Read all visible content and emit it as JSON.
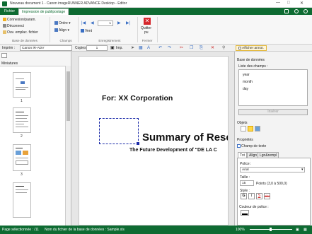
{
  "window": {
    "title": "Nouveau document 1 - Canon imageRUNNER ADVANCE Desktop - Editor"
  },
  "ribbon_tabs": [
    "Fichier",
    "Impression de publipostage"
  ],
  "ribbon": {
    "db_group": {
      "connect": "Connexion/param.",
      "disconnect": "Déconnect",
      "open_file": "Ouv. emplac. fichier",
      "label": "Base de données"
    },
    "fields_group": {
      "order": "Ordre",
      "align": "Align",
      "label": "Champs"
    },
    "records_group": {
      "page_value": "1",
      "show": "Vent",
      "label": "Enregistrement"
    },
    "close_group": {
      "quit": "Quitter",
      "quit2": "pu",
      "label": "Fermer"
    }
  },
  "printbar": {
    "printer_label": "Imprim :",
    "printer_value": "Canon iR-ADV",
    "copies_label": "Copies :",
    "copies_value": "1",
    "imp_label": "Imp.",
    "show_annot": "Afficher annot."
  },
  "left_panel": {
    "title": "Miniatures",
    "pages": [
      "1",
      "2",
      "3"
    ]
  },
  "document": {
    "for_line": "For: XX Corporation",
    "summary": "Summary of Rese",
    "subtitle": "The Future Development of “DE LA C"
  },
  "right_panel": {
    "database_label": "Base de données",
    "fields_list_label": "Liste des champs :",
    "fields": [
      "year",
      "month",
      "day"
    ],
    "insert_button": "Insérer",
    "objects_label": "Objets",
    "properties_label": "Propriétés",
    "text_field_label": "Champ de texte",
    "tabs": [
      "Txt",
      "Align",
      "Lgn&rempl"
    ],
    "font_label": "Police :",
    "font_value": "Arial",
    "size_label": "Taille :",
    "size_value": "15",
    "size_hint": "Points (3,0 à 500,0)",
    "style_label": "Style :",
    "style_buttons": [
      "G",
      "I",
      "S",
      "abc"
    ],
    "font_color_label": "Couleur de police :"
  },
  "status": {
    "page_selected": "Page sélectionnée : /11",
    "db_file": "Nom du fichier de la base de données : Sample.xls",
    "zoom": "100%"
  },
  "colors": {
    "brand": "#0e6b32",
    "quit_red": "#d6262b",
    "selection_blue": "#1a2aa8"
  }
}
